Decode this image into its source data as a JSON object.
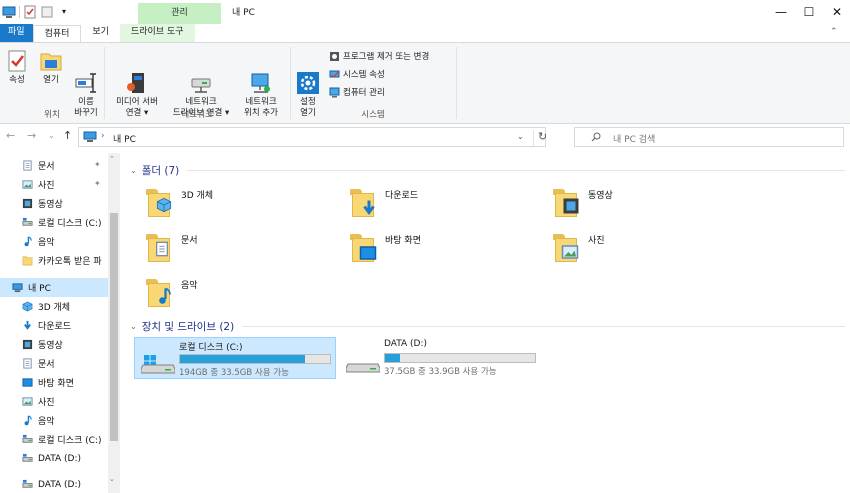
{
  "title_bar": {
    "context_tab": "관리",
    "window_title": "내 PC",
    "minimize": "—",
    "maximize": "☐",
    "close": "✕"
  },
  "tabs": [
    {
      "label": "파일"
    },
    {
      "label": "컴퓨터"
    },
    {
      "label": "보기"
    },
    {
      "label": "드라이브 도구"
    }
  ],
  "ribbon": {
    "location": {
      "properties": "속성",
      "open": "열기",
      "rename": "이름\n바꾸기",
      "label": "위치"
    },
    "network": {
      "media_server": "미디어 서버\n연결 ▾",
      "map_drive": "네트워크\n드라이브 연결 ▾",
      "add_location": "네트워크\n위치 추가",
      "label": "네트워크"
    },
    "system": {
      "settings": "설정\n열기",
      "uninstall": "프로그램 제거 또는 변경",
      "system_props": "시스템 속성",
      "manage": "컴퓨터 관리",
      "label": "시스템"
    }
  },
  "address": {
    "path_root": "›",
    "path": "내 PC",
    "search_placeholder": "내 PC 검색"
  },
  "nav": [
    {
      "label": "문서",
      "icon": "document-icon",
      "pinned": true
    },
    {
      "label": "사진",
      "icon": "pictures-icon",
      "pinned": true
    },
    {
      "label": "동영상",
      "icon": "video-icon"
    },
    {
      "label": "로컬 디스크 (C:)",
      "icon": "drive-icon"
    },
    {
      "label": "음악",
      "icon": "music-icon"
    },
    {
      "label": "카카오톡 받은 파",
      "icon": "folder-icon"
    },
    {
      "label": "내 PC",
      "icon": "computer-icon",
      "selected": true
    },
    {
      "label": "3D 개체",
      "icon": "3d-objects-icon"
    },
    {
      "label": "다운로드",
      "icon": "download-icon"
    },
    {
      "label": "동영상",
      "icon": "video-icon"
    },
    {
      "label": "문서",
      "icon": "document-icon"
    },
    {
      "label": "바탕 화면",
      "icon": "desktop-icon"
    },
    {
      "label": "사진",
      "icon": "pictures-icon"
    },
    {
      "label": "음악",
      "icon": "music-icon"
    },
    {
      "label": "로컬 디스크 (C:)",
      "icon": "drive-icon"
    },
    {
      "label": "DATA (D:)",
      "icon": "drive-icon"
    },
    {
      "label": "DATA (D:)",
      "icon": "drive-icon"
    }
  ],
  "folders_header": "폴더 (7)",
  "folders": [
    {
      "label": "3D 개체",
      "icon": "3d-objects-icon"
    },
    {
      "label": "다운로드",
      "icon": "download-icon"
    },
    {
      "label": "동영상",
      "icon": "video-icon"
    },
    {
      "label": "문서",
      "icon": "document-icon"
    },
    {
      "label": "바탕 화면",
      "icon": "desktop-icon"
    },
    {
      "label": "사진",
      "icon": "pictures-icon"
    },
    {
      "label": "음악",
      "icon": "music-icon"
    }
  ],
  "drives_header": "장치 및 드라이브 (2)",
  "drives": [
    {
      "label": "로컬 디스크 (C:)",
      "free": "194GB 중 33.5GB 사용 가능",
      "used_fraction": 0.83,
      "selected": true
    },
    {
      "label": "DATA (D:)",
      "free": "37.5GB 중 33.9GB 사용 가능",
      "used_fraction": 0.1
    }
  ],
  "colors": {
    "accent": "#1979ca",
    "drive_bar": "#26a0da",
    "selection": "#cce8ff",
    "context_tab": "#c6efc4"
  }
}
